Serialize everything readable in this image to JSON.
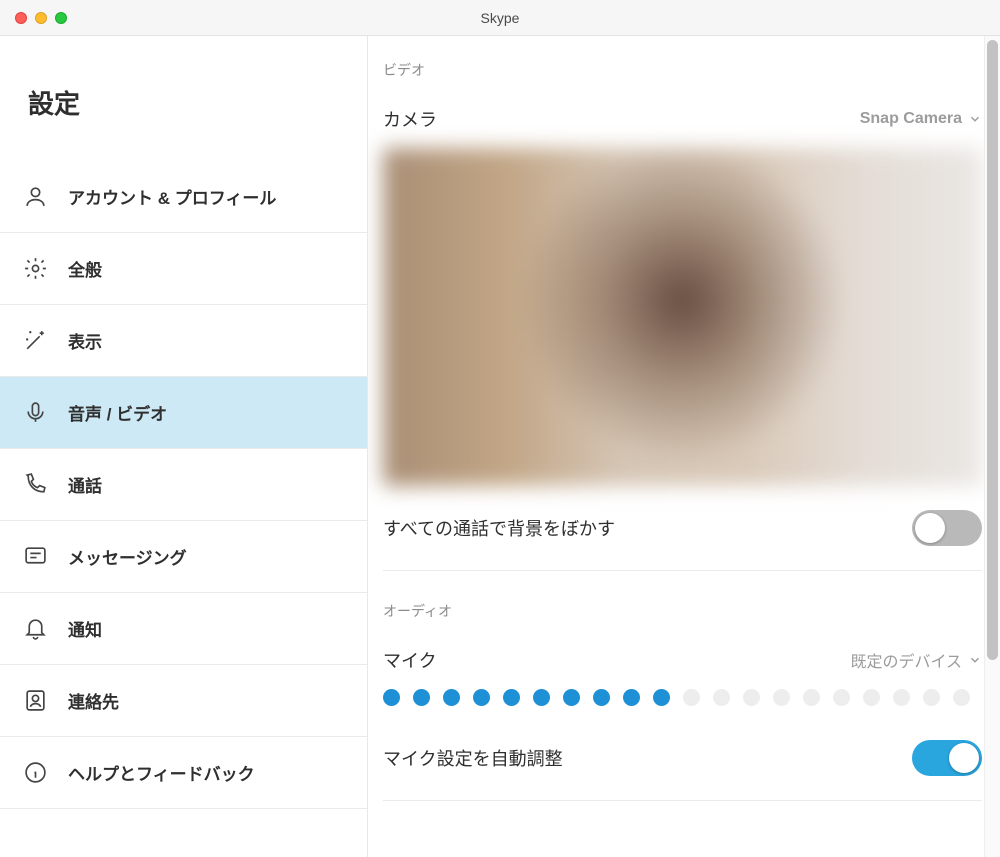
{
  "window": {
    "title": "Skype"
  },
  "sidebar": {
    "heading": "設定",
    "items": [
      {
        "label": "アカウント & プロフィール"
      },
      {
        "label": "全般"
      },
      {
        "label": "表示"
      },
      {
        "label": "音声 / ビデオ"
      },
      {
        "label": "通話"
      },
      {
        "label": "メッセージング"
      },
      {
        "label": "通知"
      },
      {
        "label": "連絡先"
      },
      {
        "label": "ヘルプとフィードバック"
      }
    ]
  },
  "video": {
    "section_label": "ビデオ",
    "camera_label": "カメラ",
    "camera_value": "Snap Camera",
    "blur_label": "すべての通話で背景をぼかす",
    "blur_enabled": false
  },
  "audio": {
    "section_label": "オーディオ",
    "mic_label": "マイク",
    "mic_value": "既定のデバイス",
    "mic_level_active": 10,
    "mic_level_total": 20,
    "auto_adjust_label": "マイク設定を自動調整",
    "auto_adjust_enabled": true
  }
}
